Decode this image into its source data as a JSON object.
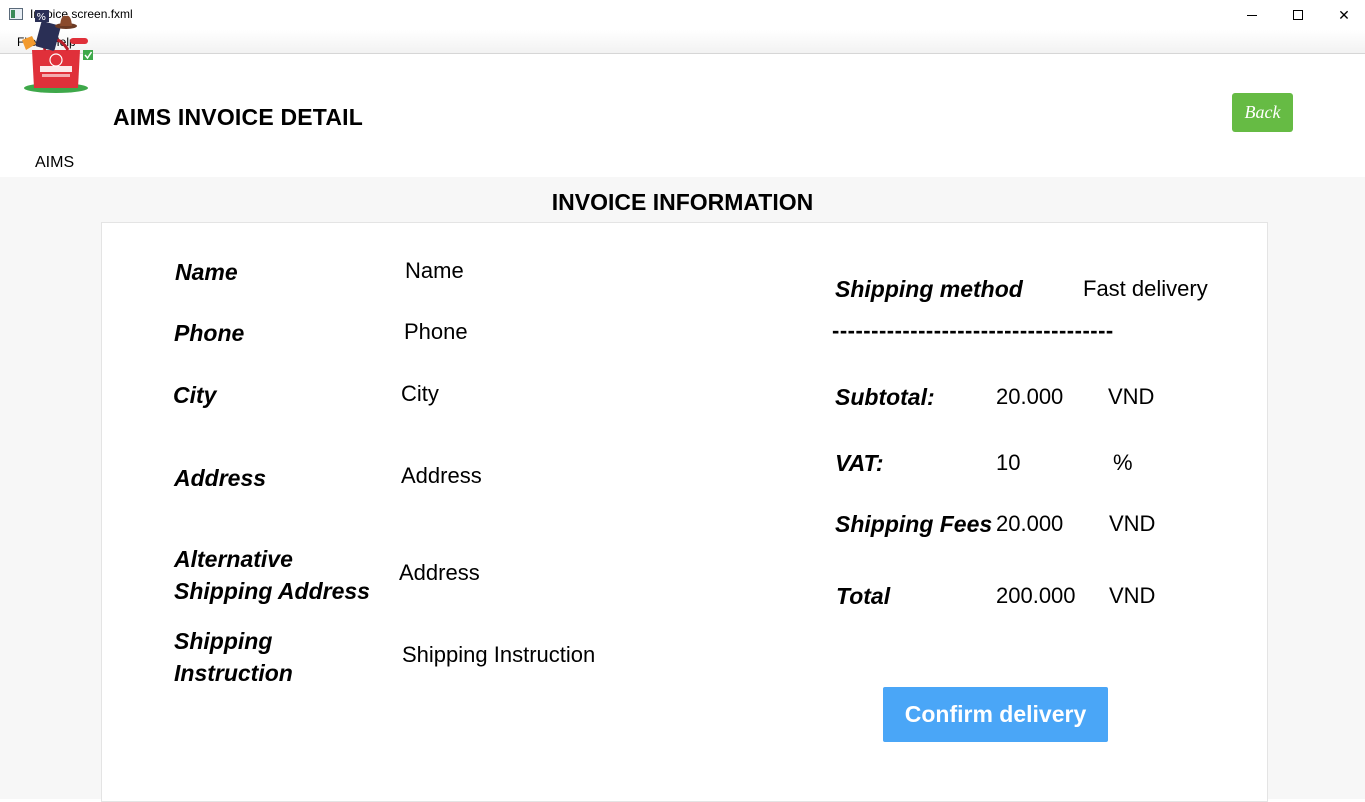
{
  "window": {
    "title": "Invoice screen.fxml",
    "min_icon": "minimize-icon",
    "max_icon": "maximize-icon",
    "close_symbol": "✕"
  },
  "menu": {
    "file": "File",
    "help": "Help"
  },
  "header": {
    "logo_text": "AIMS",
    "title": "AIMS INVOICE DETAIL",
    "back_label": "Back"
  },
  "section_title": "INVOICE INFORMATION",
  "customer": {
    "name_label": "Name",
    "name_value": "Name",
    "phone_label": "Phone",
    "phone_value": "Phone",
    "city_label": "City",
    "city_value": "City",
    "address_label": "Address",
    "address_value": "Address",
    "alt_address_label_1": "Alternative",
    "alt_address_label_2": "Shipping Address",
    "alt_address_value": "Address",
    "instruction_label_1": "Shipping",
    "instruction_label_2": "Instruction",
    "instruction_value": "Shipping Instruction"
  },
  "summary": {
    "shipping_method_label": "Shipping method",
    "shipping_method_value": "Fast delivery",
    "divider": "------------------------------------",
    "subtotal_label": "Subtotal:",
    "subtotal_value": "20.000",
    "subtotal_unit": "VND",
    "vat_label": "VAT:",
    "vat_value": "10",
    "vat_unit": "%",
    "fees_label": "Shipping Fees",
    "fees_value": "20.000",
    "fees_unit": "VND",
    "total_label": "Total",
    "total_value": "200.000",
    "total_unit": "VND"
  },
  "confirm_label": "Confirm delivery",
  "colors": {
    "back_button": "#66bb44",
    "confirm_button": "#4aa6f7",
    "background": "#f7f7f7"
  }
}
